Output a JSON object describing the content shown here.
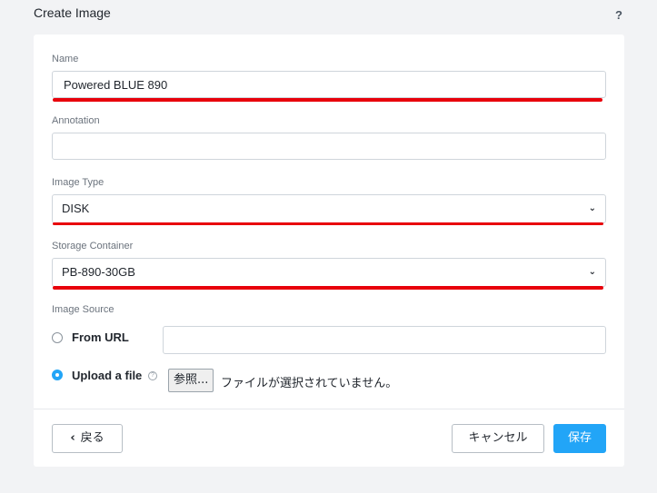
{
  "dialog": {
    "title": "Create Image",
    "help": "?"
  },
  "form": {
    "name": {
      "label": "Name",
      "value": "Powered BLUE 890"
    },
    "annotation": {
      "label": "Annotation",
      "value": ""
    },
    "image_type": {
      "label": "Image Type",
      "value": "DISK"
    },
    "storage_container": {
      "label": "Storage Container",
      "value": "PB-890-30GB"
    },
    "image_source": {
      "label": "Image Source",
      "from_url_label": "From URL",
      "from_url_value": "",
      "upload_label": "Upload a file",
      "selected": "upload",
      "browse_button": "参照...",
      "file_status": "ファイルが選択されていません。"
    }
  },
  "footer": {
    "back_label": "戻る",
    "cancel_label": "キャンセル",
    "save_label": "保存"
  },
  "colors": {
    "accent": "#22a5f7",
    "annotation_red": "#e8000b"
  }
}
